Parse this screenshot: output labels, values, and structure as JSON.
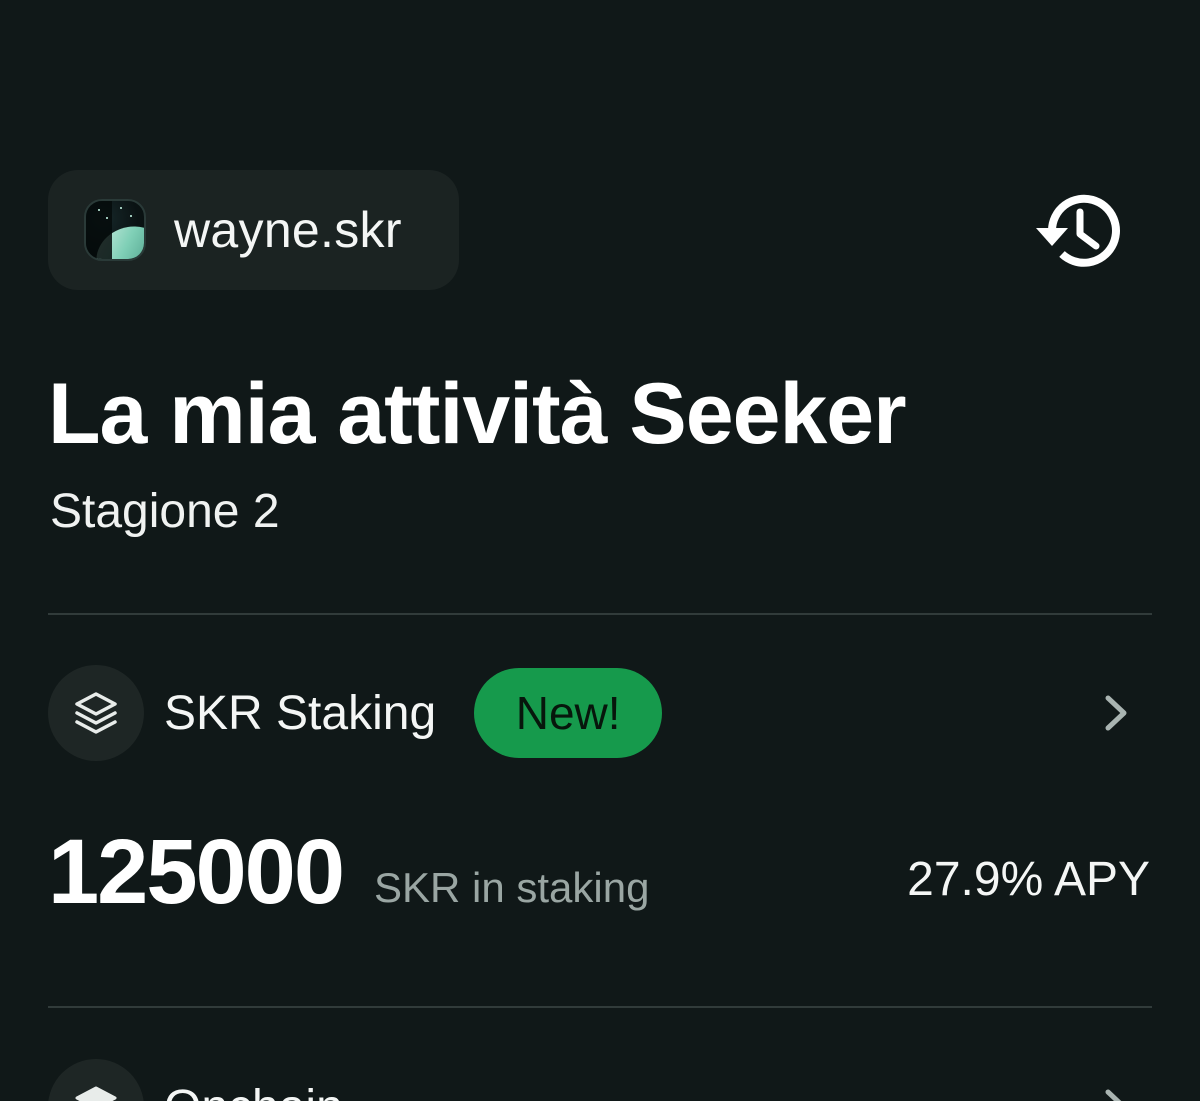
{
  "account": {
    "name": "wayne.skr",
    "avatar_icon": "profile-avatar"
  },
  "header": {
    "history_icon": "history-icon"
  },
  "page": {
    "title": "La mia attività Seeker",
    "season": "Stagione 2"
  },
  "staking": {
    "icon": "layers-icon",
    "label": "SKR Staking",
    "badge": "New!",
    "badge_color": "#169a4c",
    "amount": "125000",
    "amount_unit": "SKR in staking",
    "apy": "27.9% APY"
  },
  "onchain": {
    "icon": "layers-icon",
    "label": "Onchain"
  },
  "colors": {
    "background": "#101818",
    "chip": "#1b2322",
    "muted_text": "#9aa6a3",
    "divider": "#313b3a"
  }
}
